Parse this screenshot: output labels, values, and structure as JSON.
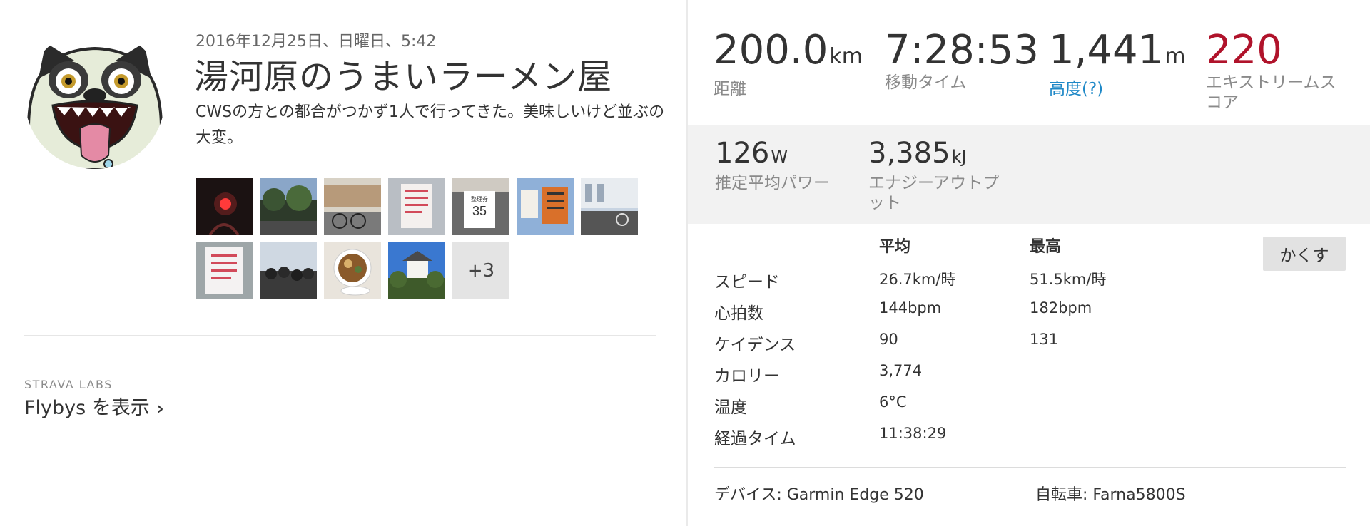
{
  "activity": {
    "date": "2016年12月25日、日曜日、5:42",
    "title": "湯河原のうまいラーメン屋",
    "description": "CWSの方との都合がつかず1人で行ってきた。美味しいけど並ぶの大変。"
  },
  "photos": {
    "more_label": "+3",
    "items": [
      {
        "name": "photo-bike-rear-light",
        "caption": ""
      },
      {
        "name": "photo-trees",
        "caption": ""
      },
      {
        "name": "photo-parked-bikes",
        "caption": ""
      },
      {
        "name": "photo-notice-sign",
        "caption": ""
      },
      {
        "name": "photo-number-ticket",
        "caption": "35"
      },
      {
        "name": "photo-orange-sign",
        "caption": ""
      },
      {
        "name": "photo-building",
        "caption": ""
      },
      {
        "name": "photo-notice-sign-2",
        "caption": ""
      },
      {
        "name": "photo-queue",
        "caption": ""
      },
      {
        "name": "photo-ramen-bowl",
        "caption": ""
      },
      {
        "name": "photo-castle",
        "caption": ""
      }
    ]
  },
  "labs": {
    "kicker": "STRAVA LABS",
    "flybys_label": "Flybys を表示"
  },
  "stats": {
    "distance": {
      "value": "200.0",
      "unit": "km",
      "label": "距離"
    },
    "moving_time": {
      "value": "7:28:53",
      "unit": "",
      "label": "移動タイム"
    },
    "elevation": {
      "value": "1,441",
      "unit": "m",
      "label": "高度(?)"
    },
    "suffer": {
      "value": "220",
      "unit": "",
      "label_line1": "エキストリームス",
      "label_line2": "コア"
    },
    "power": {
      "value": "126",
      "unit": "W",
      "label": "推定平均パワー"
    },
    "energy": {
      "value": "3,385",
      "unit": "kJ",
      "label_line1": "エナジーアウトプ",
      "label_line2": "ット"
    }
  },
  "table": {
    "header_avg": "平均",
    "header_max": "最高",
    "hide_label": "かくす",
    "rows": [
      {
        "name": "スピード",
        "avg": "26.7km/時",
        "max": "51.5km/時"
      },
      {
        "name": "心拍数",
        "avg": "144bpm",
        "max": "182bpm"
      },
      {
        "name": "ケイデンス",
        "avg": "90",
        "max": "131"
      },
      {
        "name": "カロリー",
        "avg": "3,774",
        "max": ""
      },
      {
        "name": "温度",
        "avg": "6°C",
        "max": ""
      },
      {
        "name": "経過タイム",
        "avg": "11:38:29",
        "max": ""
      }
    ]
  },
  "gear": {
    "device": "デバイス: Garmin Edge 520",
    "bike": "自転車: Farna5800S"
  },
  "colors": {
    "suffer_score": "#b0132b",
    "link": "#1e88c7",
    "secondary_bg": "#f2f2f2"
  }
}
